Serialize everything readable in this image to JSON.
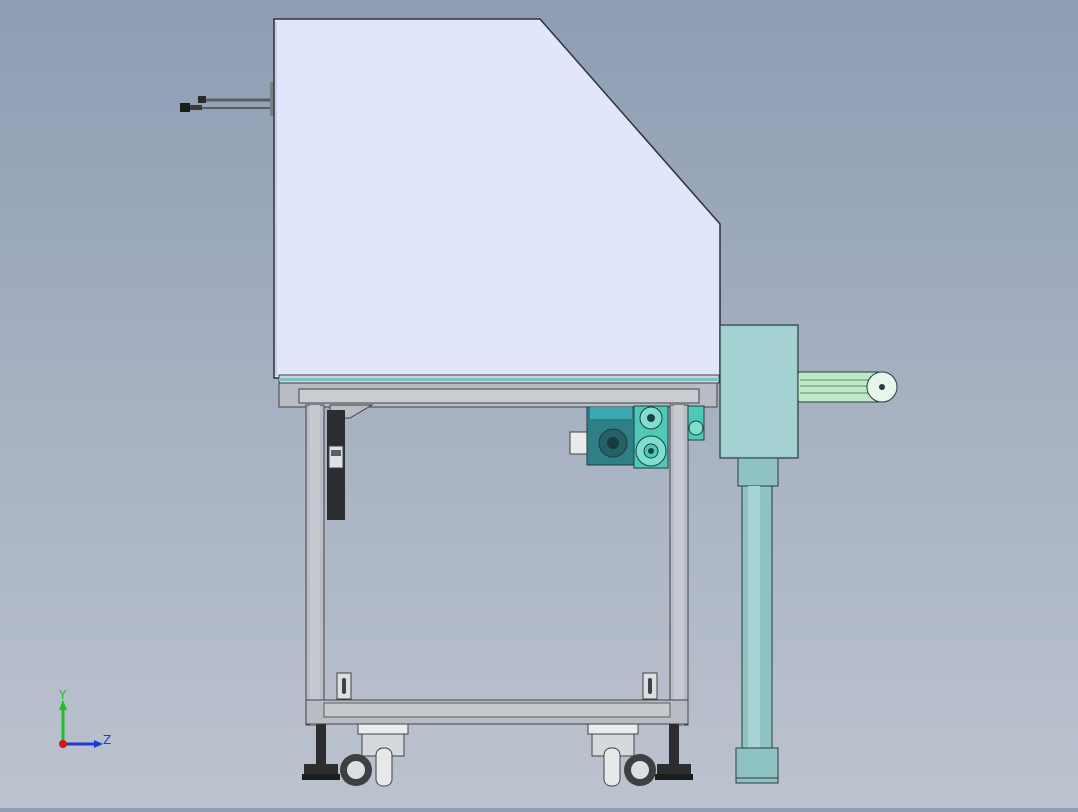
{
  "viewport": {
    "background_top": "#8e9db3",
    "background_bottom": "#bcc3cf"
  },
  "model": {
    "hood_color": "#e2e6fb",
    "frame_color": "#b9bdc3",
    "frame_edge": "#3f4247",
    "motor_color": "#3aa7b2",
    "gearbox_color": "#2f7f86",
    "pulley_color": "#4fc8b8",
    "column_color": "#8fc3c3",
    "column_head_color": "#9ccdcd",
    "belt_color": "#bfe8c8"
  },
  "triad": {
    "y_label": "Y",
    "z_label": "Z",
    "y_color": "#1fbf2a",
    "z_color": "#1f3bd6",
    "x_color": "#d01818"
  }
}
